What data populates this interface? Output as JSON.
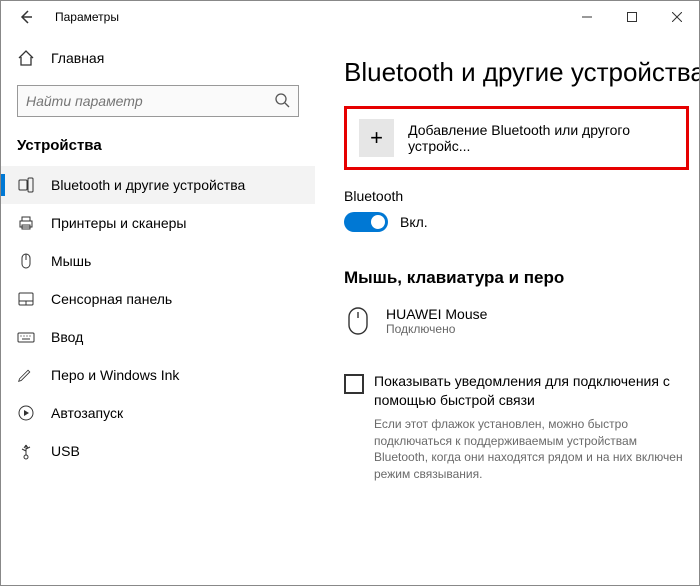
{
  "titlebar": {
    "title": "Параметры"
  },
  "sidebar": {
    "home": "Главная",
    "search_placeholder": "Найти параметр",
    "section": "Устройства",
    "items": [
      {
        "label": "Bluetooth и другие устройства"
      },
      {
        "label": "Принтеры и сканеры"
      },
      {
        "label": "Мышь"
      },
      {
        "label": "Сенсорная панель"
      },
      {
        "label": "Ввод"
      },
      {
        "label": "Перо и Windows Ink"
      },
      {
        "label": "Автозапуск"
      },
      {
        "label": "USB"
      }
    ]
  },
  "content": {
    "heading": "Bluetooth и другие устройства",
    "add_device": "Добавление Bluetooth или другого устройс...",
    "bt_section": "Bluetooth",
    "bt_state": "Вкл.",
    "mouse_heading": "Мышь, клавиатура и перо",
    "device": {
      "name": "HUAWEI  Mouse",
      "status": "Подключено"
    },
    "checkbox_label": "Показывать уведомления для подключения с помощью быстрой связи",
    "help": "Если этот флажок установлен, можно быстро подключаться к поддерживаемым устройствам Bluetooth, когда они находятся рядом и на них включен режим связывания."
  }
}
